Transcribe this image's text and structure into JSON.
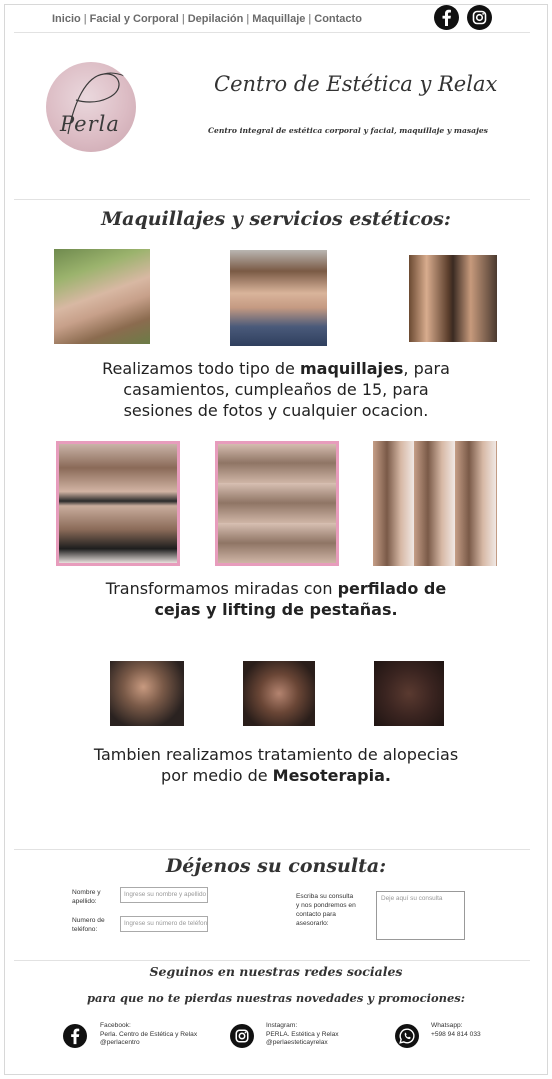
{
  "nav": {
    "items": [
      {
        "label": "Inicio"
      },
      {
        "label": "Facial y Corporal"
      },
      {
        "label": "Depilación"
      },
      {
        "label": "Maquillaje"
      },
      {
        "label": "Contacto"
      }
    ],
    "separator": "|"
  },
  "social_top": {
    "facebook_icon": "facebook-icon",
    "instagram_icon": "instagram-icon"
  },
  "header": {
    "logo_text": "Perla",
    "title": "Centro de Estética y Relax",
    "subtitle": "Centro integral de estética corporal y facial, maquillaje y masajes"
  },
  "services": {
    "title": "Maquillajes y servicios estéticos:",
    "makeup": {
      "pre": "Realizamos todo tipo de ",
      "bold": "maquillajes",
      "post_line1": ", para",
      "line2": "casamientos, cumpleaños de 15, para",
      "line3": "sesiones de fotos y cualquier ocacion."
    },
    "brows": {
      "pre": "Transformamos miradas con ",
      "bold1": "perfilado de",
      "bold2": "cejas y lifting de pestañas."
    },
    "alopecia": {
      "line1": "Tambien realizamos tratamiento de alopecias",
      "pre2": "por medio de ",
      "bold2": "Mesoterapia."
    }
  },
  "contact_form": {
    "title": "Déjenos su consulta:",
    "name_label": "Nombre y apellido:",
    "name_placeholder": "Ingrese su nombre y apellido",
    "phone_label": "Numero de teléfono:",
    "phone_placeholder": "Ingrese su número de teléfono",
    "message_label": "Escriba su consulta y nos pondremos en contacto para asesorarlo:",
    "message_placeholder": "Deje aquí su consulta"
  },
  "follow": {
    "line1": "Seguinos en nuestras redes sociales",
    "line2": "para que no te pierdas nuestras novedades y promociones:"
  },
  "contacts": [
    {
      "icon": "facebook-icon",
      "head": "Facebook:",
      "line1": "Perla. Centro de Estética y Relax",
      "line2": "@perlacentro"
    },
    {
      "icon": "instagram-icon",
      "head": "Instagram:",
      "line1": "PERLA. Estética y Relax",
      "line2": "@perlaesteticayrelax"
    },
    {
      "icon": "whatsapp-icon",
      "head": "Whatsapp:",
      "line1": "+598 94 814 033",
      "line2": ""
    }
  ],
  "colors": {
    "accent_pink": "#e79cbc",
    "logo_pink": "#dcbcc4",
    "icon_dark": "#111111"
  }
}
